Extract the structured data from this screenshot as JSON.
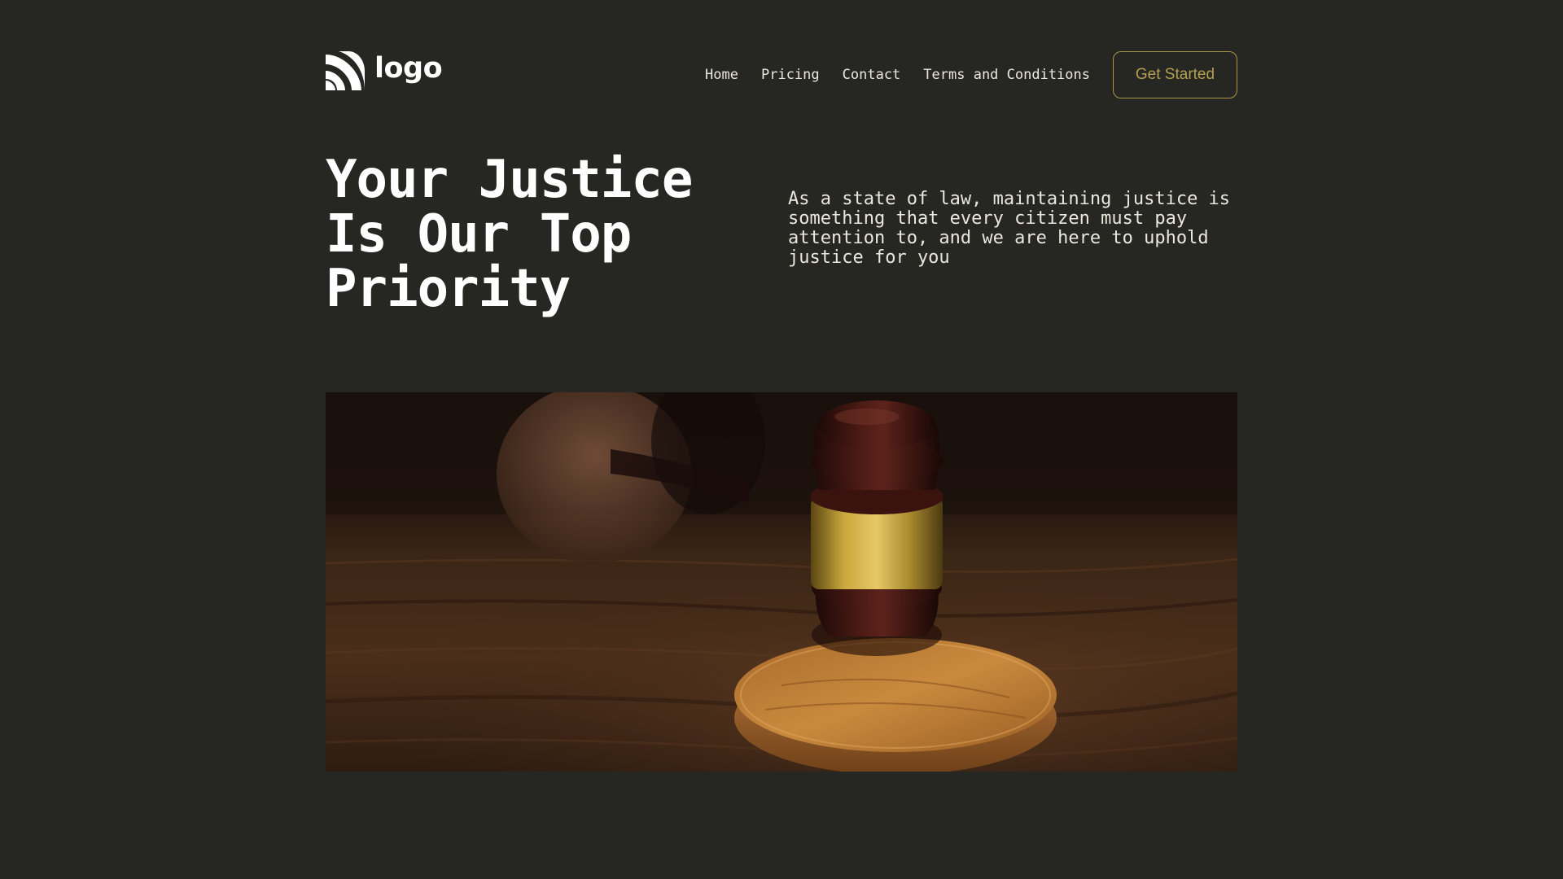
{
  "header": {
    "logo_text": "logo",
    "logo_icon": "signal-arcs-icon",
    "nav": [
      {
        "label": "Home"
      },
      {
        "label": "Pricing"
      },
      {
        "label": "Contact"
      },
      {
        "label": "Terms and Conditions"
      }
    ],
    "cta_label": "Get Started"
  },
  "hero": {
    "title_lines": [
      "Your Justice",
      "Is Our Top",
      "Priority"
    ],
    "description": "As a state of law, maintaining justice is something that every citizen must pay attention to, and we are here to uphold justice for you"
  },
  "colors": {
    "background": "#262622",
    "accent": "#b3a053",
    "text": "#ffffff"
  }
}
